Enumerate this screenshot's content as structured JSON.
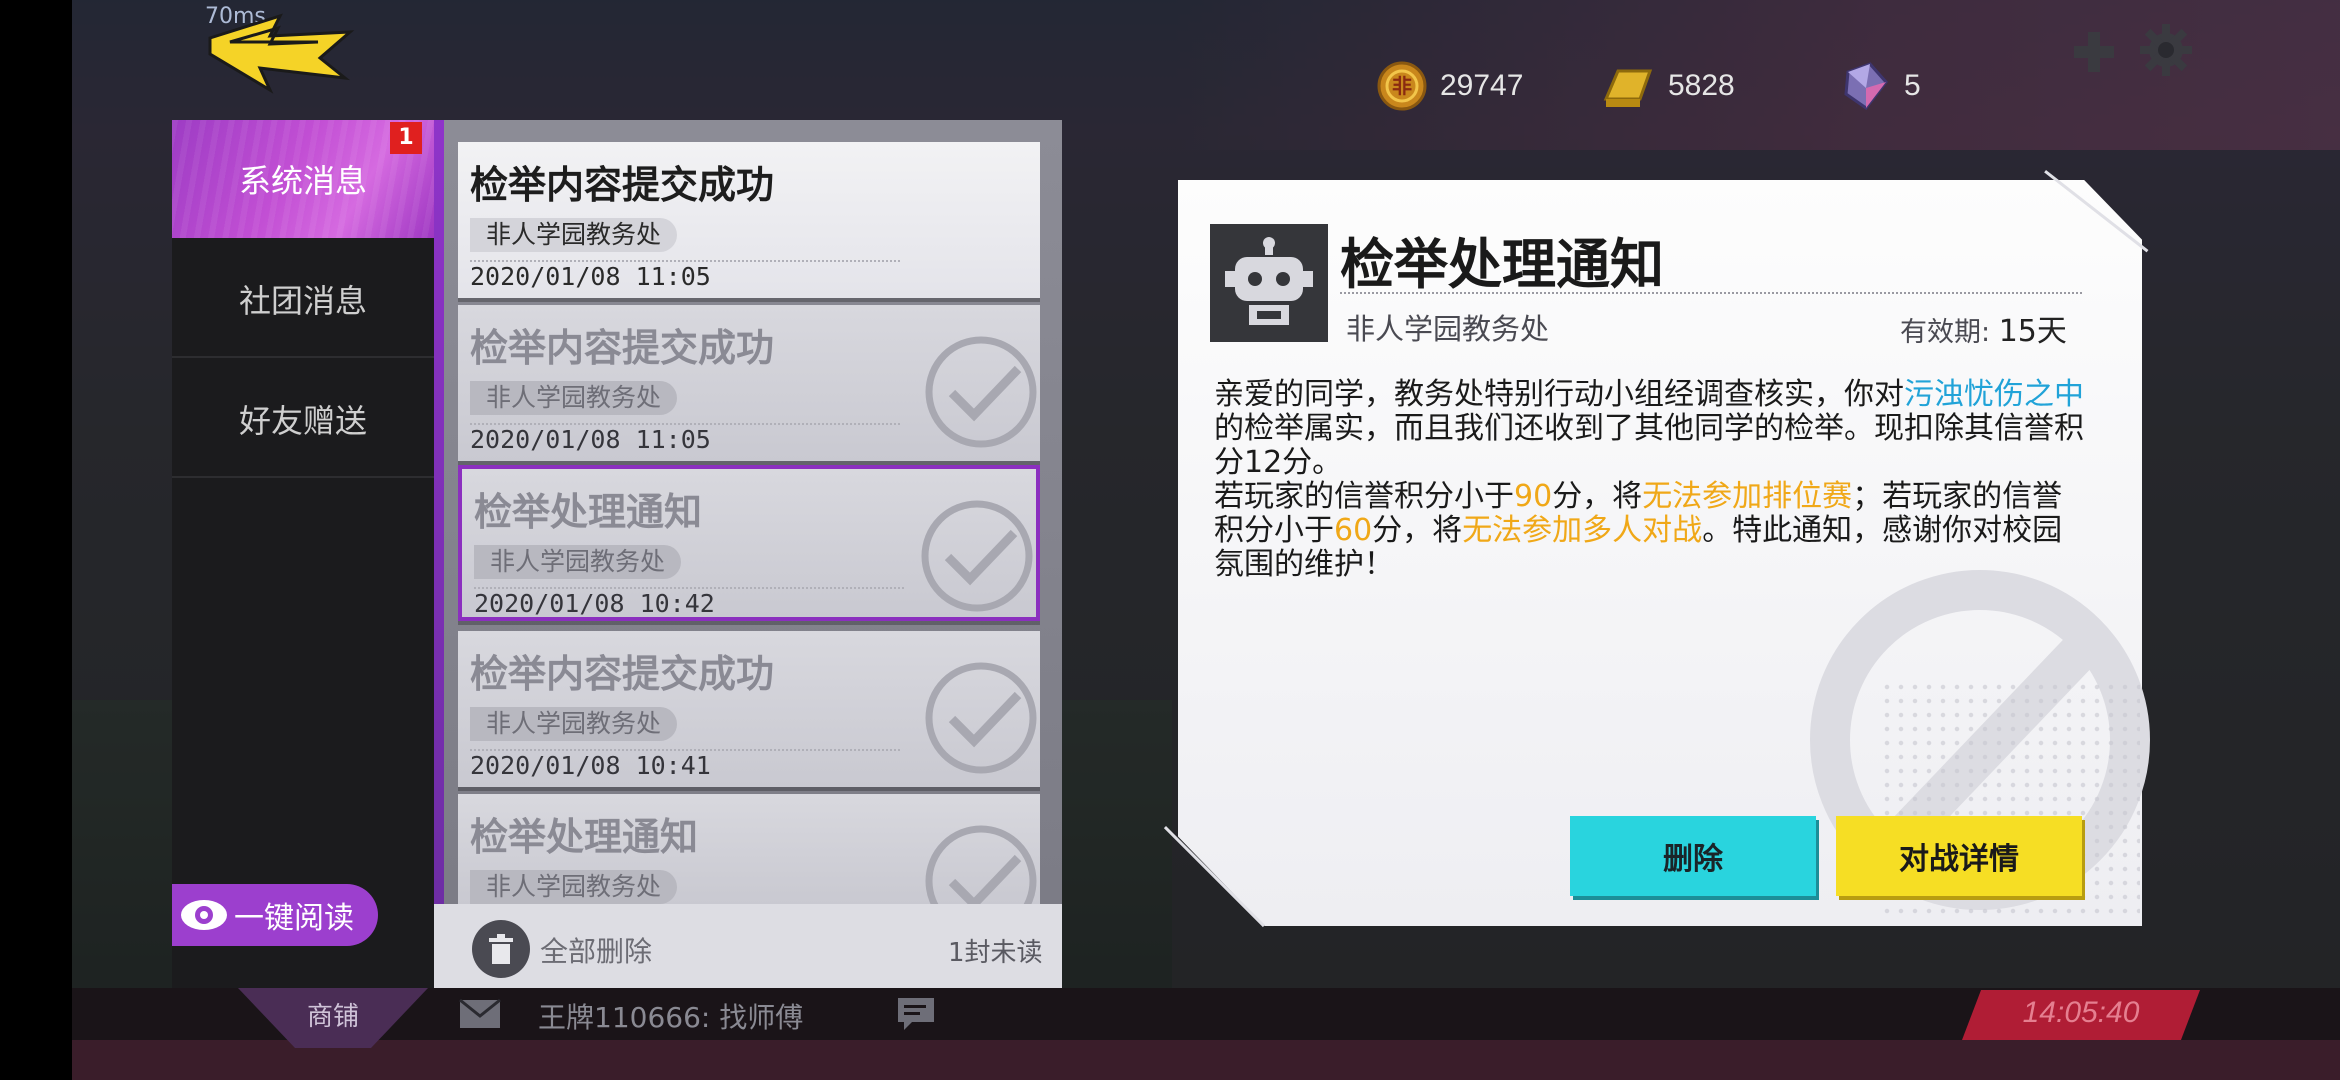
{
  "top_bar": {
    "ping": "70ms",
    "coins": "29747",
    "gold": "5828",
    "gems": "5",
    "coin_icon": "coin-icon",
    "gold_icon": "gold-bar-icon",
    "gem_icon": "gem-icon",
    "plus_icon": "plus-icon",
    "settings_icon": "gear-icon",
    "back_icon": "back-arrow-icon"
  },
  "categories": [
    {
      "label": "系统消息",
      "badge": "1",
      "active": true
    },
    {
      "label": "社团消息",
      "active": false
    },
    {
      "label": "好友赠送",
      "active": false
    }
  ],
  "read_all_label": "一键阅读",
  "messages": [
    {
      "title": "检举内容提交成功",
      "sender": "非人学园教务处",
      "date": "2020/01/08 11:05",
      "read": false,
      "selected": false
    },
    {
      "title": "检举内容提交成功",
      "sender": "非人学园教务处",
      "date": "2020/01/08 11:05",
      "read": true,
      "selected": false
    },
    {
      "title": "检举处理通知",
      "sender": "非人学园教务处",
      "date": "2020/01/08 10:42",
      "read": true,
      "selected": true
    },
    {
      "title": "检举内容提交成功",
      "sender": "非人学园教务处",
      "date": "2020/01/08 10:41",
      "read": true,
      "selected": false
    },
    {
      "title": "检举处理通知",
      "sender": "非人学园教务处",
      "date": "",
      "read": true,
      "selected": false
    }
  ],
  "list_footer": {
    "delete_all_label": "全部删除",
    "unread_count": "1封未读"
  },
  "detail": {
    "title": "检举处理通知",
    "sender": "非人学园教务处",
    "validity_label": "有效期:",
    "validity_value": "15天",
    "body": {
      "p1_a": "亲爱的同学，教务处特别行动小组经调查核实，你对",
      "p1_name": "污浊忧伤之中",
      "p1_b": "的检举属实，而且我们还收到了其他同学的检举。现扣除其信誉积分12分。",
      "p2_a": "若玩家的信誉积分小于",
      "p2_n1": "90",
      "p2_b": "分，将",
      "p2_r1": "无法参加排位赛",
      "p2_c": "；若玩家的信誉积分小于",
      "p2_n2": "60",
      "p2_d": "分，将",
      "p2_r2": "无法参加多人对战",
      "p2_e": "。特此通知，感谢你对校园氛围的维护！"
    },
    "delete_label": "删除",
    "battle_label": "对战详情"
  },
  "bottom_bar": {
    "shop_label": "商铺",
    "chat_text": "王牌110666: 找师傅",
    "clock": "14:05:40"
  },
  "colors": {
    "accent_purple": "#9c3fce",
    "highlight_blue": "#21a3d8",
    "highlight_orange": "#f0a818",
    "delete_button": "#29d4de",
    "battle_button": "#f6de24"
  }
}
